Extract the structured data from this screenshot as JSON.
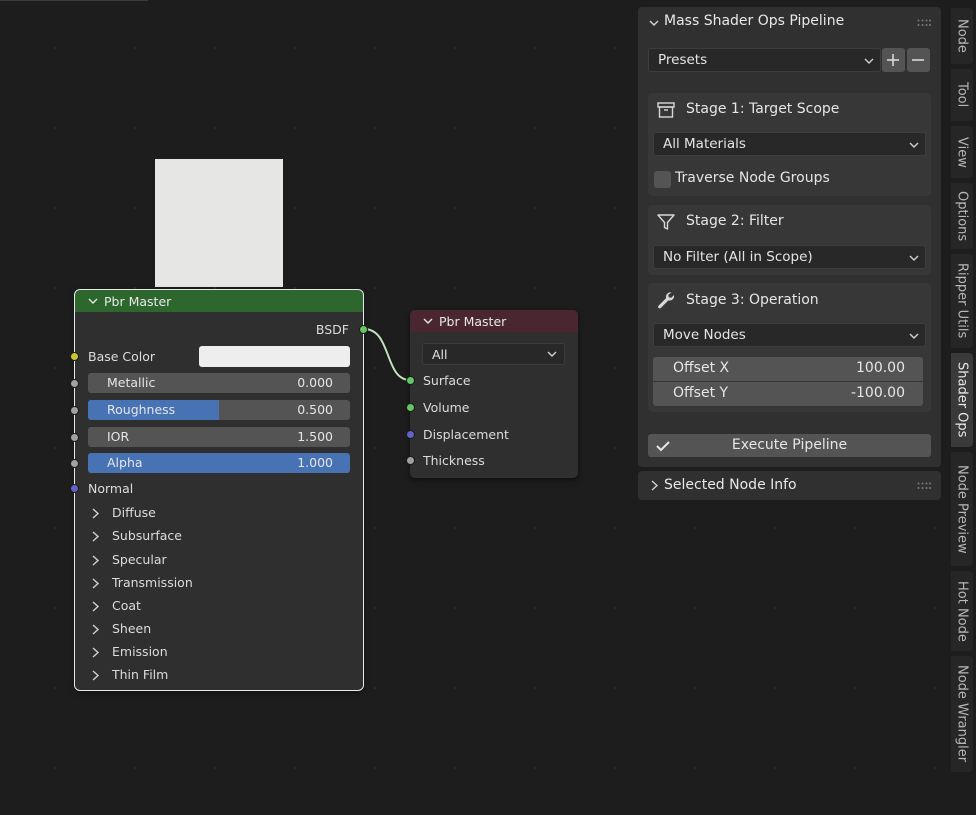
{
  "editor": {
    "preview_node": "white-preview-thumbnail",
    "node1": {
      "title": "Pbr Master",
      "header_color": "#2e672e",
      "output_label": "BSDF",
      "base_color_label": "Base Color",
      "base_color_value": "#eeeeee",
      "normal_label": "Normal",
      "fields": [
        {
          "label": "Metallic",
          "value": "0.000",
          "fill": 0.0
        },
        {
          "label": "Roughness",
          "value": "0.500",
          "fill": 0.5
        },
        {
          "label": "IOR",
          "value": "1.500",
          "fill": 0.0
        },
        {
          "label": "Alpha",
          "value": "1.000",
          "fill": 1.0
        }
      ],
      "panels": [
        "Diffuse",
        "Subsurface",
        "Specular",
        "Transmission",
        "Coat",
        "Sheen",
        "Emission",
        "Thin Film"
      ]
    },
    "node2": {
      "title": "Pbr Master",
      "header_color": "#4a2630",
      "target_select": "All",
      "inputs": [
        {
          "label": "Surface",
          "color": "green"
        },
        {
          "label": "Volume",
          "color": "green"
        },
        {
          "label": "Displacement",
          "color": "blue"
        },
        {
          "label": "Thickness",
          "color": "gray"
        }
      ]
    }
  },
  "sidebar": {
    "panel_title": "Mass Shader Ops Pipeline",
    "presets_label": "Presets",
    "stage1": {
      "title": "Stage 1: Target Scope",
      "scope_value": "All Materials",
      "checkbox_label": "Traverse Node Groups",
      "checkbox_checked": false
    },
    "stage2": {
      "title": "Stage 2: Filter",
      "filter_value": "No Filter (All in Scope)"
    },
    "stage3": {
      "title": "Stage 3: Operation",
      "operation_value": "Move Nodes",
      "offset_x_label": "Offset X",
      "offset_x_value": "100.00",
      "offset_y_label": "Offset Y",
      "offset_y_value": "-100.00"
    },
    "execute_label": "Execute Pipeline",
    "info_panel_title": "Selected Node Info"
  },
  "tabs": [
    "Node",
    "Tool",
    "View",
    "Options",
    "Ripper Utils",
    "Shader Ops",
    "Node Preview",
    "Hot Node",
    "Node Wrangler"
  ],
  "active_tab": "Shader Ops"
}
